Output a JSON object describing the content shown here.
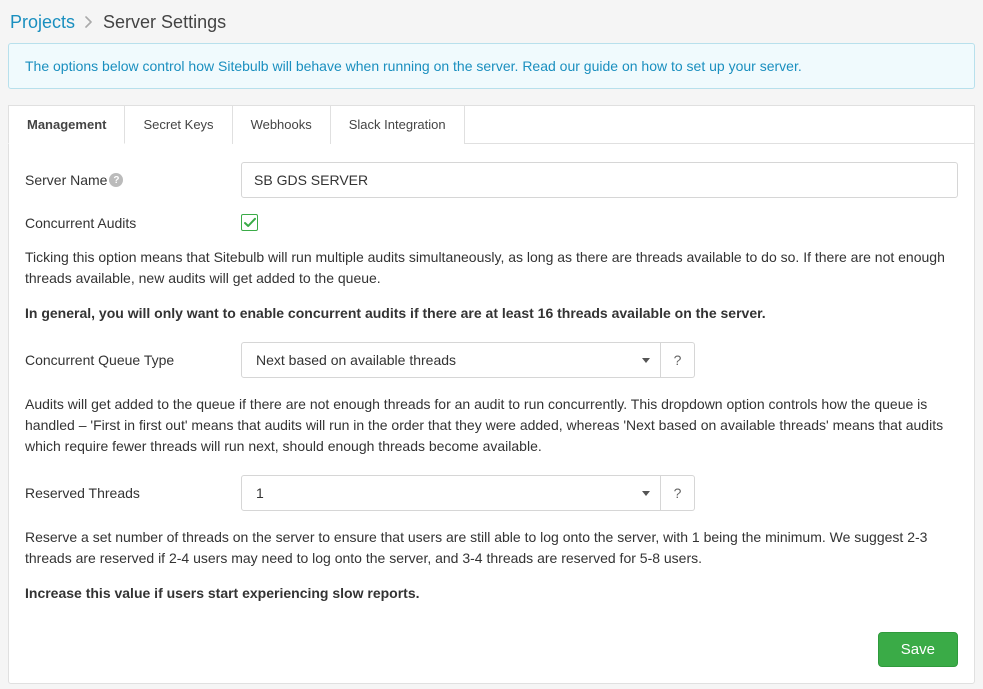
{
  "breadcrumb": {
    "root": "Projects",
    "title": "Server Settings"
  },
  "banner": {
    "prefix": "The options below control how Sitebulb will behave when running on the server. ",
    "link": "Read our guide",
    "suffix": " on how to set up your server."
  },
  "tabs": [
    {
      "label": "Management",
      "active": true
    },
    {
      "label": "Secret Keys",
      "active": false
    },
    {
      "label": "Webhooks",
      "active": false
    },
    {
      "label": "Slack Integration",
      "active": false
    }
  ],
  "form": {
    "server_name_label": "Server Name",
    "server_name_value": "SB GDS SERVER",
    "concurrent_audits_label": "Concurrent Audits",
    "concurrent_audits_checked": true,
    "concurrent_audits_desc": "Ticking this option means that Sitebulb will run multiple audits simultaneously, as long as there are threads available to do so. If there are not enough threads available, new audits will get added to the queue.",
    "concurrent_audits_strong": "In general, you will only want to enable concurrent audits if there are at least 16 threads available on the server.",
    "queue_type_label": "Concurrent Queue Type",
    "queue_type_value": "Next based on available threads",
    "queue_type_desc": "Audits will get added to the queue if there are not enough threads for an audit to run concurrently. This dropdown option controls how the queue is handled – 'First in first out' means that audits will run in the order that they were added, whereas 'Next based on available threads' means that audits which require fewer threads will run next, should enough threads become available.",
    "reserved_threads_label": "Reserved Threads",
    "reserved_threads_value": "1",
    "reserved_threads_desc": "Reserve a set number of threads on the server to ensure that users are still able to log onto the server, with 1 being the minimum. We suggest 2-3 threads are reserved if 2-4 users may need to log onto the server, and 3-4 threads are reserved for 5-8 users.",
    "reserved_threads_strong": "Increase this value if users start experiencing slow reports.",
    "help_symbol": "?"
  },
  "footer": {
    "save_label": "Save"
  }
}
